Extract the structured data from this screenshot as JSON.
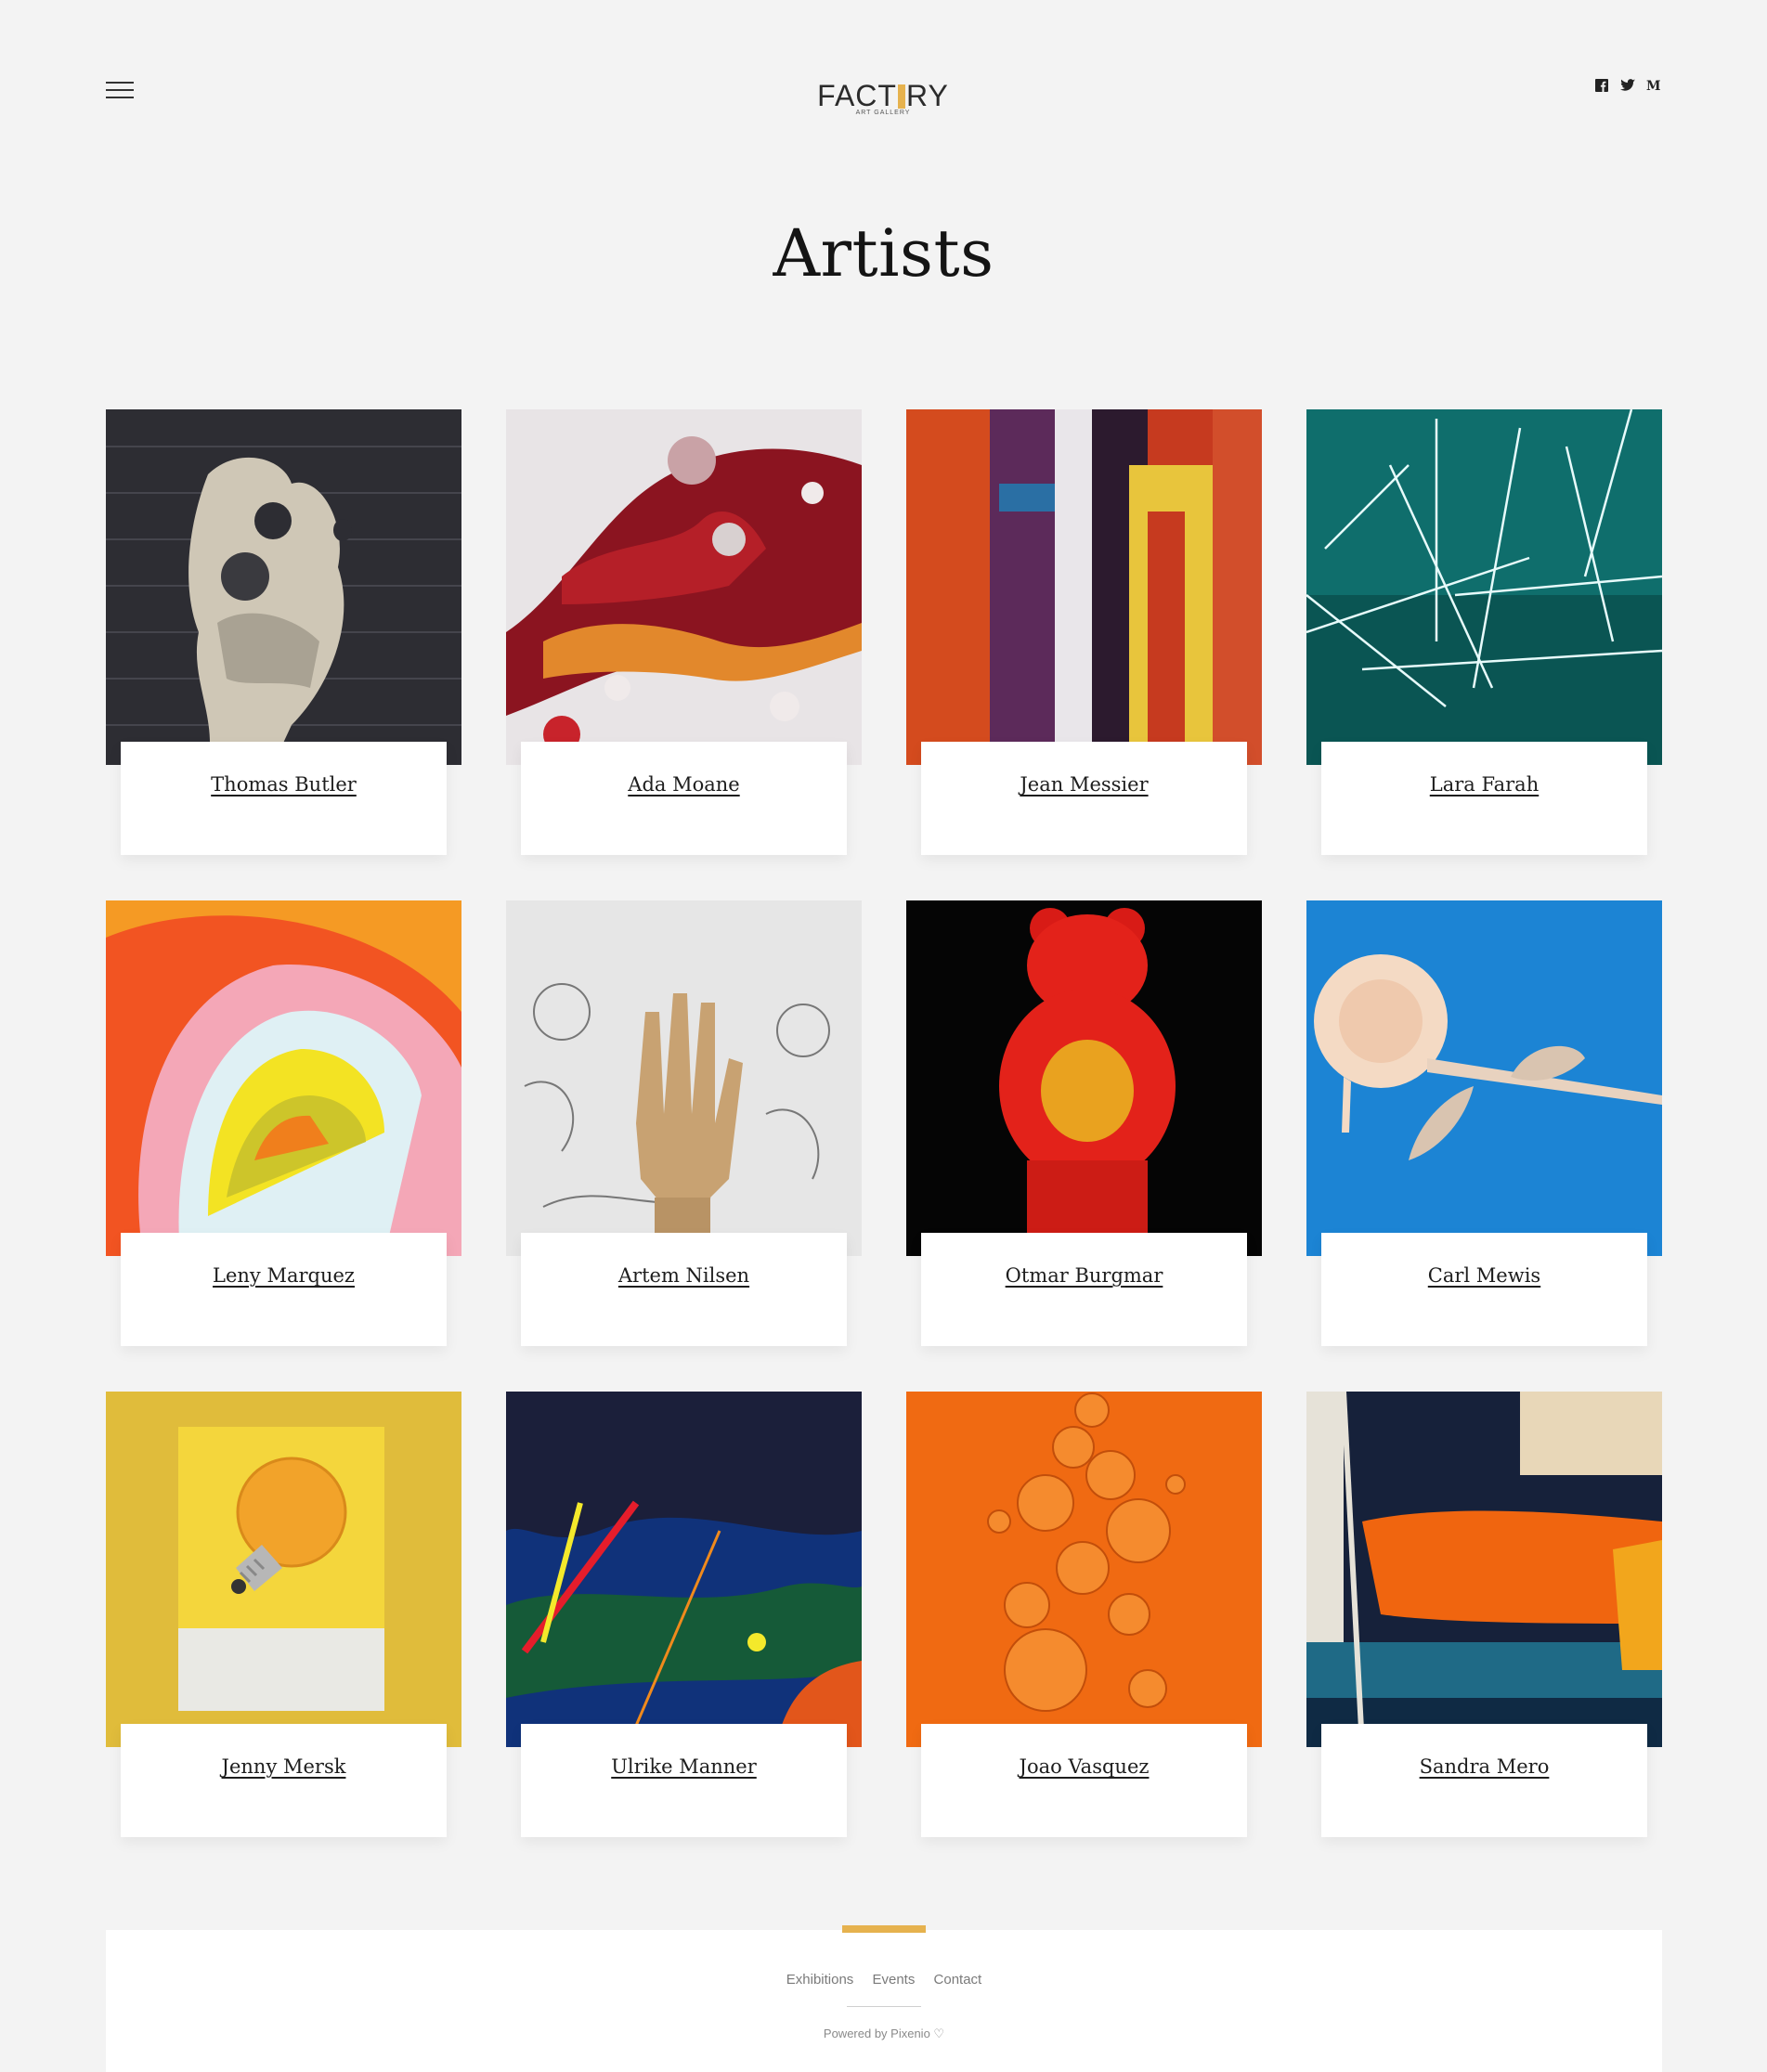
{
  "header": {
    "logo_text_left": "FACT",
    "logo_text_right": "RY",
    "logo_subtitle": "ART GALLERY",
    "social": [
      {
        "name": "facebook-icon",
        "glyph": "f"
      },
      {
        "name": "twitter-icon",
        "glyph": "t"
      },
      {
        "name": "medium-icon",
        "glyph": "M"
      }
    ]
  },
  "page": {
    "title": "Artists"
  },
  "artists": [
    {
      "name": "Thomas Butler"
    },
    {
      "name": "Ada Moane"
    },
    {
      "name": "Jean Messier"
    },
    {
      "name": "Lara Farah"
    },
    {
      "name": "Leny Marquez"
    },
    {
      "name": "Artem Nilsen"
    },
    {
      "name": "Otmar Burgmar"
    },
    {
      "name": "Carl Mewis"
    },
    {
      "name": "Jenny Mersk"
    },
    {
      "name": "Ulrike Manner"
    },
    {
      "name": "Joao Vasquez"
    },
    {
      "name": "Sandra Mero"
    }
  ],
  "footer": {
    "links": [
      "Exhibitions",
      "Events",
      "Contact"
    ],
    "powered": "Powered by Pixenio ♡"
  },
  "colors": {
    "accent": "#e6b24e",
    "background": "#f3f3f3"
  }
}
